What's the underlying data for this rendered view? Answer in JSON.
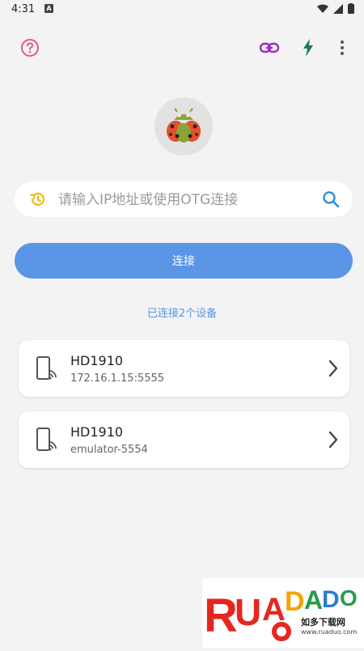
{
  "status": {
    "time": "4:31",
    "notif": "A"
  },
  "search": {
    "placeholder": "请输入IP地址或使用OTG连接"
  },
  "connect": {
    "label": "连接"
  },
  "connected": {
    "label": "已连接2个设备"
  },
  "devices": [
    {
      "name": "HD1910",
      "address": "172.16.1.15:5555"
    },
    {
      "name": "HD1910",
      "address": "emulator-5554"
    }
  ],
  "watermark": {
    "brand": "RUADADO",
    "sub": "如多下载网",
    "url": "www.ruaduo.com"
  },
  "colors": {
    "accent": "#5b95e6",
    "help": "#e85a7b",
    "link": "#9b2fbf",
    "flash": "#1a7a4f",
    "history": "#f4b400"
  }
}
